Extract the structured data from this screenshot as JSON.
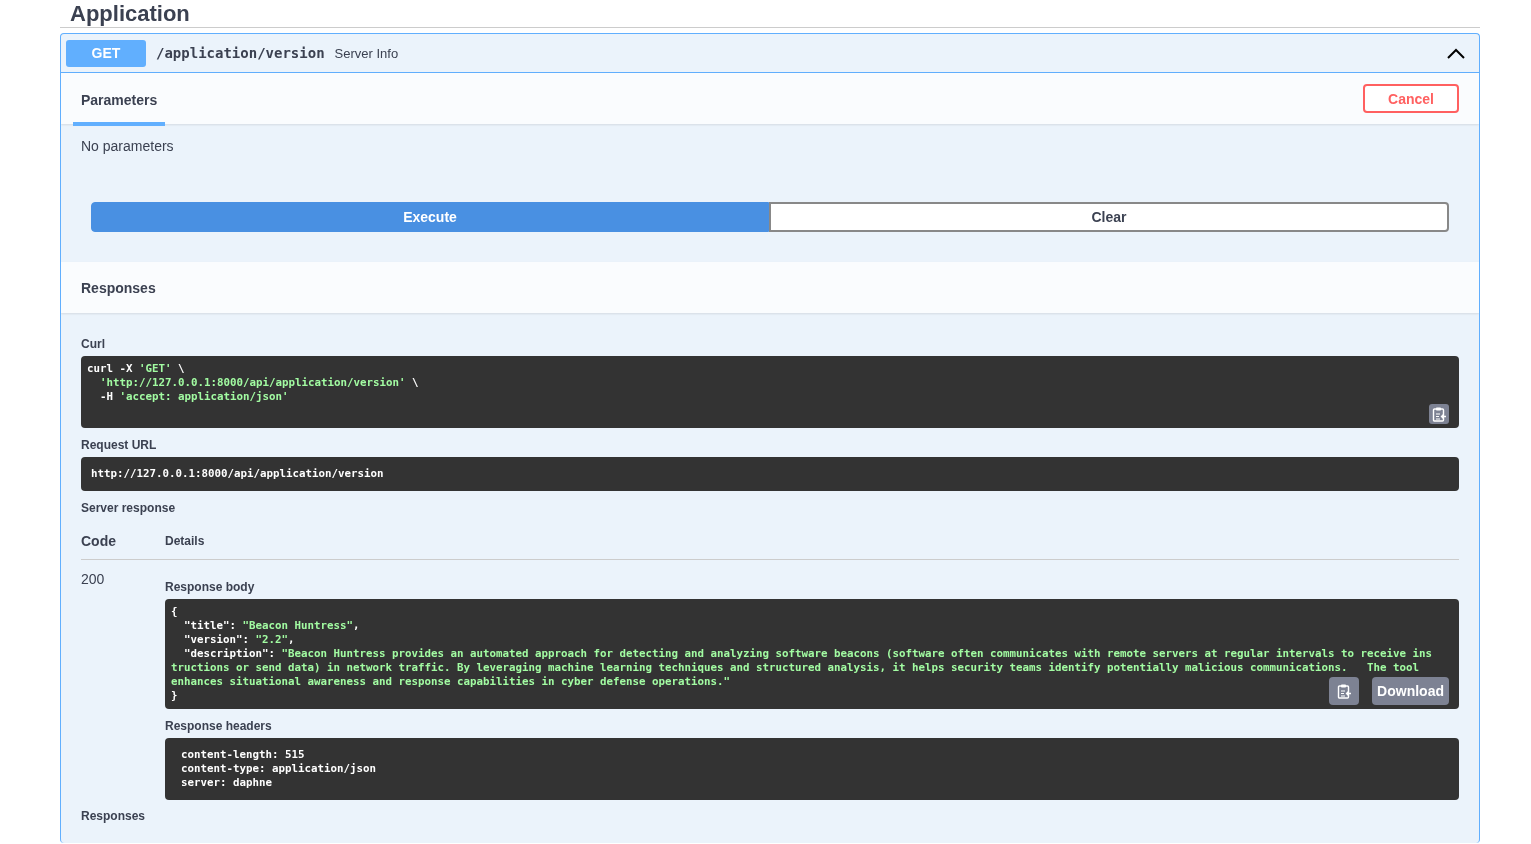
{
  "section": {
    "title": "Application"
  },
  "operation": {
    "method": "GET",
    "path": "/application/version",
    "summary": "Server Info",
    "expanded": true
  },
  "tabs": [
    {
      "label": "Parameters",
      "selected": true
    }
  ],
  "cancel_button": "Cancel",
  "no_parameters": "No parameters",
  "actions": [
    "Execute",
    "Clear"
  ],
  "responses_heading": "Responses",
  "curl": {
    "label": "Curl",
    "lines": [
      [
        {
          "text": "curl -X ",
          "kind": "plain"
        },
        {
          "text": "'GET'",
          "kind": "string"
        },
        {
          "text": " \\",
          "kind": "plain"
        }
      ],
      [
        {
          "text": "  'http://127.0.0.1:8000/api/application/version'",
          "kind": "string"
        },
        {
          "text": " \\",
          "kind": "plain"
        }
      ],
      [
        {
          "text": "  -H ",
          "kind": "plain"
        },
        {
          "text": "'accept: application/json'",
          "kind": "string"
        }
      ]
    ]
  },
  "request_url": {
    "label": "Request URL",
    "value": "http://127.0.0.1:8000/api/application/version"
  },
  "server_response": {
    "label": "Server response",
    "columns": [
      "Code",
      "Details"
    ],
    "code": "200",
    "body_label": "Response body",
    "body_lines": [
      [
        {
          "text": "{",
          "kind": "plain"
        }
      ],
      [
        {
          "text": "  \"title\": ",
          "kind": "plain"
        },
        {
          "text": "\"Beacon Huntress\"",
          "kind": "string"
        },
        {
          "text": ",",
          "kind": "plain"
        }
      ],
      [
        {
          "text": "  \"version\": ",
          "kind": "plain"
        },
        {
          "text": "\"2.2\"",
          "kind": "string"
        },
        {
          "text": ",",
          "kind": "plain"
        }
      ],
      [
        {
          "text": "  \"description\": ",
          "kind": "plain"
        },
        {
          "text": "\"Beacon Huntress provides an automated approach for detecting and analyzing software beacons (software often communicates with remote servers at regular intervals to receive ins",
          "kind": "string"
        }
      ],
      [
        {
          "text": "tructions or send data) in network traffic. By leveraging machine learning techniques and structured analysis, it helps security teams identify potentially malicious communications.   The tool",
          "kind": "string"
        }
      ],
      [
        {
          "text": "enhances situational awareness and response capabilities in cyber defense operations.\"",
          "kind": "string"
        }
      ],
      [
        {
          "text": "}",
          "kind": "plain"
        }
      ]
    ],
    "download_button": "Download",
    "headers_label": "Response headers",
    "header_lines": [
      [
        {
          "text": "content-length: 515",
          "kind": "plain"
        }
      ],
      [
        {
          "text": "content-type: application/json",
          "kind": "plain"
        }
      ],
      [
        {
          "text": "server: daphne",
          "kind": "plain"
        }
      ]
    ]
  },
  "responses_footer": "Responses"
}
